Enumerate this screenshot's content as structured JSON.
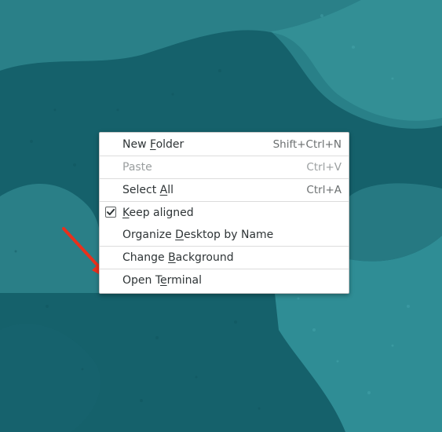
{
  "menu": {
    "items": [
      {
        "pre": "New ",
        "mnemonic": "F",
        "post": "older",
        "shortcut": "Shift+Ctrl+N",
        "enabled": true
      },
      {
        "pre": "Paste",
        "mnemonic": "",
        "post": "",
        "shortcut": "Ctrl+V",
        "enabled": false
      },
      {
        "pre": "Select ",
        "mnemonic": "A",
        "post": "ll",
        "shortcut": "Ctrl+A",
        "enabled": true
      },
      {
        "pre": "",
        "mnemonic": "K",
        "post": "eep aligned",
        "shortcut": "",
        "enabled": true,
        "checked": true
      },
      {
        "pre": "Organize ",
        "mnemonic": "D",
        "post": "esktop by Name",
        "shortcut": "",
        "enabled": true
      },
      {
        "pre": "Change ",
        "mnemonic": "B",
        "post": "ackground",
        "shortcut": "",
        "enabled": true
      },
      {
        "pre": "Open T",
        "mnemonic": "e",
        "post": "rminal",
        "shortcut": "",
        "enabled": true
      }
    ]
  },
  "colors": {
    "wallpaper_dark": "#15616b",
    "wallpaper_light": "#2e8891",
    "arrow": "#e8301c"
  },
  "icons": {
    "checkbox": "check-icon",
    "annotation": "red-arrow-icon"
  }
}
